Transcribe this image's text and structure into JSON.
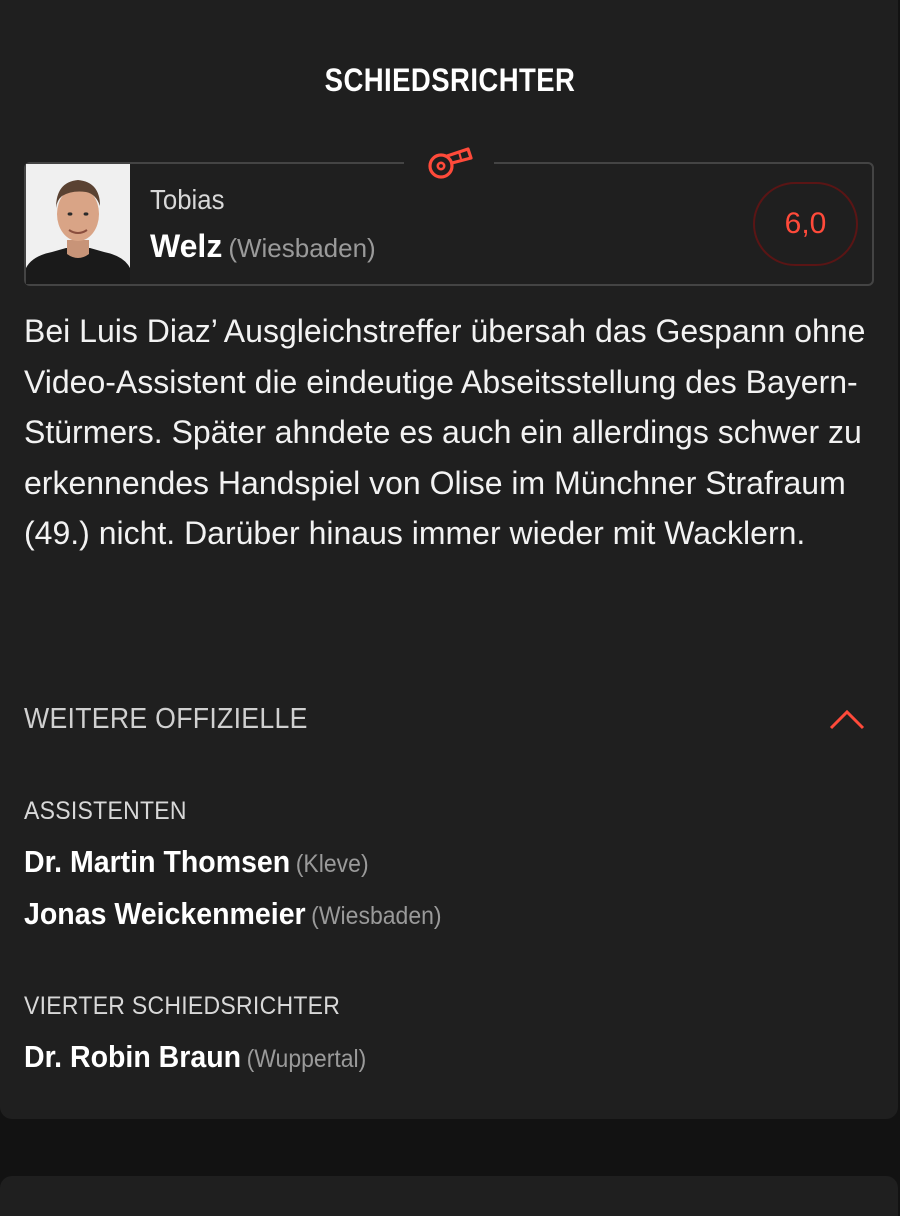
{
  "section": {
    "title": "SCHIEDSRICHTER"
  },
  "referee": {
    "first_name": "Tobias",
    "last_name": "Welz",
    "city": "(Wiesbaden)",
    "grade": "6,0",
    "icon": "whistle-icon"
  },
  "description": "Bei Luis Diaz’ Ausgleichstreffer übersah das Gespann ohne Video-Assistent die eindeutige Abseitsstellung des Bayern-Stürmers. Später ahndete es auch ein allerdings schwer zu erkennendes Handspiel von Olise im Münchner Strafraum (49.) nicht. Darüber hinaus immer wieder mit Wacklern.",
  "officials": {
    "header": "WEITERE OFFIZIELLE",
    "toggle_icon": "chevron-up-icon",
    "assistants_label": "ASSISTENTEN",
    "assistants": [
      {
        "name": "Dr. Martin Thomsen",
        "city": "(Kleve)"
      },
      {
        "name": "Jonas Weickenmeier",
        "city": "(Wiesbaden)"
      }
    ],
    "fourth_label": "VIERTER SCHIEDSRICHTER",
    "fourth": {
      "name": "Dr. Robin Braun",
      "city": "(Wuppertal)"
    }
  },
  "colors": {
    "accent": "#ff4a3a",
    "background": "#121212",
    "card": "#1f1f1f"
  }
}
